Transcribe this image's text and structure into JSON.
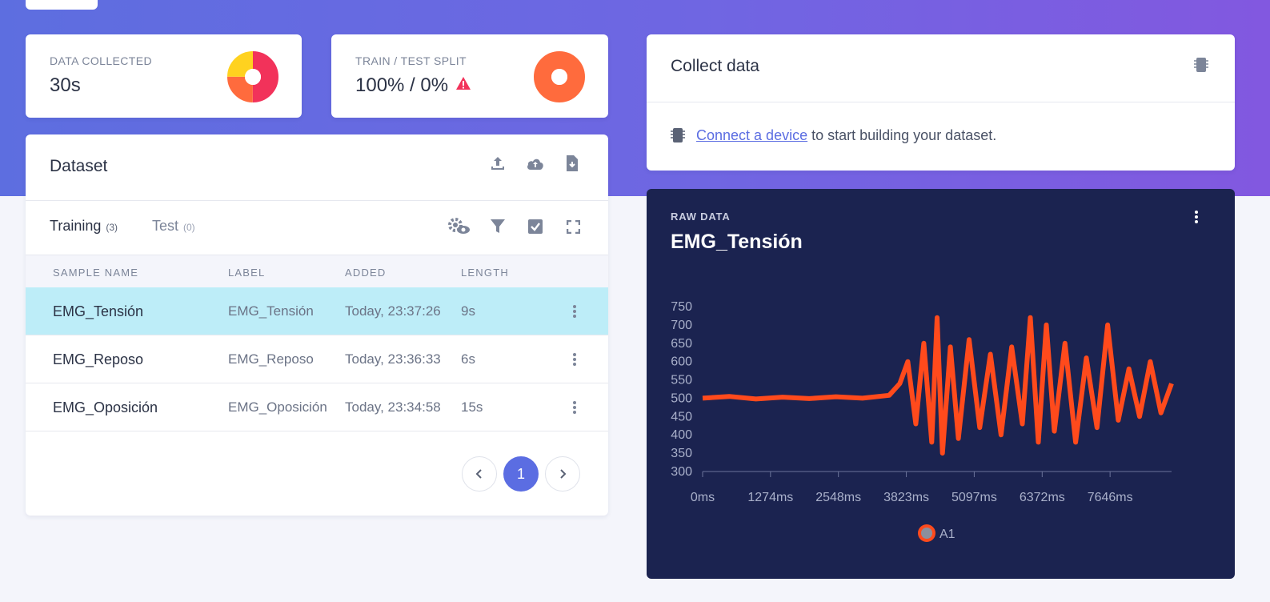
{
  "stats": {
    "data_collected": {
      "label": "DATA COLLECTED",
      "value": "30s"
    },
    "split": {
      "label": "TRAIN / TEST SPLIT",
      "value": "100% / 0%"
    }
  },
  "dataset": {
    "title": "Dataset",
    "tabs": [
      {
        "label": "Training",
        "count": "(3)"
      },
      {
        "label": "Test",
        "count": "(0)"
      }
    ],
    "columns": [
      "SAMPLE NAME",
      "LABEL",
      "ADDED",
      "LENGTH"
    ],
    "rows": [
      {
        "name": "EMG_Tensión",
        "label": "EMG_Tensión",
        "added": "Today, 23:37:26",
        "length": "9s",
        "selected": true
      },
      {
        "name": "EMG_Reposo",
        "label": "EMG_Reposo",
        "added": "Today, 23:36:33",
        "length": "6s",
        "selected": false
      },
      {
        "name": "EMG_Oposición",
        "label": "EMG_Oposición",
        "added": "Today, 23:34:58",
        "length": "15s",
        "selected": false
      }
    ],
    "pagination": {
      "current": "1"
    }
  },
  "collect": {
    "title": "Collect data",
    "link_text": "Connect a device",
    "rest_text": " to start building your dataset."
  },
  "raw": {
    "label": "RAW DATA",
    "title": "EMG_Tensión"
  },
  "colors": {
    "accent": "#5b6de2",
    "signal": "#ff4a1c",
    "panel": "#1b2350",
    "selected_row": "#bdedf8"
  },
  "chart_data": {
    "type": "line",
    "title": "EMG_Tensión",
    "xlabel": "",
    "ylabel": "",
    "x_ticks": [
      "0ms",
      "1274ms",
      "2548ms",
      "3823ms",
      "5097ms",
      "6372ms",
      "7646ms"
    ],
    "y_ticks": [
      "750",
      "700",
      "650",
      "600",
      "550",
      "500",
      "450",
      "400",
      "350",
      "300"
    ],
    "xlim": [
      0,
      8800
    ],
    "ylim": [
      300,
      750
    ],
    "legend": [
      "A1"
    ],
    "series": [
      {
        "name": "A1",
        "x": [
          0,
          500,
          1000,
          1500,
          2000,
          2500,
          3000,
          3500,
          3700,
          3850,
          4000,
          4150,
          4300,
          4400,
          4500,
          4650,
          4800,
          5000,
          5200,
          5400,
          5600,
          5800,
          6000,
          6150,
          6300,
          6450,
          6600,
          6800,
          7000,
          7200,
          7400,
          7600,
          7800,
          8000,
          8200,
          8400,
          8600,
          8800
        ],
        "values": [
          500,
          505,
          498,
          503,
          499,
          504,
          500,
          508,
          540,
          600,
          430,
          650,
          380,
          720,
          350,
          640,
          390,
          660,
          420,
          620,
          400,
          640,
          430,
          720,
          380,
          700,
          410,
          650,
          380,
          610,
          420,
          700,
          440,
          580,
          450,
          600,
          460,
          540
        ]
      }
    ]
  }
}
